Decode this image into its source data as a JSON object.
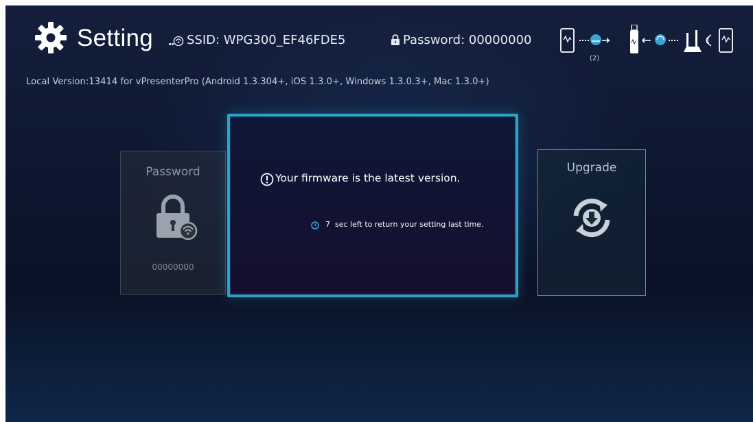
{
  "header": {
    "title": "Setting",
    "ssid": "SSID: WPG300_EF46FDE5",
    "password": "Password: 00000000",
    "topology_count": "(2)"
  },
  "version_text": "Local Version:13414 for vPresenterPro (Android 1.3.304+, iOS 1.3.0+, Windows 1.3.0.3+, Mac 1.3.0+)",
  "cards": {
    "password": {
      "label": "Password",
      "value": "00000000"
    },
    "upgrade": {
      "label": "Upgrade"
    }
  },
  "dialog": {
    "message": "Your firmware is the latest version.",
    "countdown": "7",
    "countdown_text": "sec left to return your setting last time."
  },
  "colors": {
    "accent": "#2fa4c4",
    "upgrade_border": "#3aa6b2",
    "background": "#0d1730"
  },
  "icons": {
    "title": "gear-icon",
    "ssid": "wifi-signal-icon",
    "password": "lock-icon",
    "topology": "network-topology-icon",
    "password_card": "lock-wifi-icon",
    "upgrade_card": "download-refresh-icon",
    "alert": "exclamation-circle-icon",
    "timer": "clock-icon"
  }
}
